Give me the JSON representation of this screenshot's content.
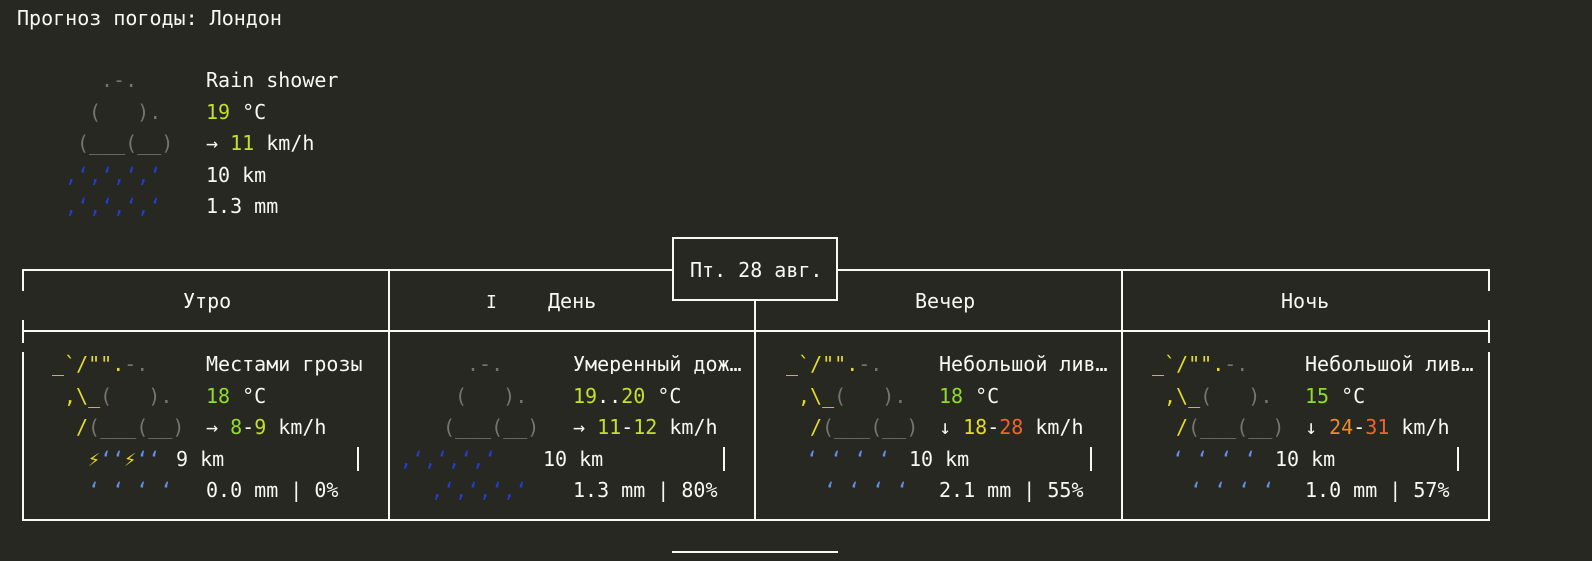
{
  "title": "Прогноз погоды: Лондон",
  "current": {
    "condition": "Rain shower",
    "temp_value": "19",
    "temp_unit": "°C",
    "wind_dir": "→",
    "wind_value": "11",
    "wind_unit": "km/h",
    "visibility": "10 km",
    "precip": "1.3 mm"
  },
  "date_label": "Пт. 28 авг.",
  "periods": [
    {
      "name": "Утро",
      "condition": "Местами грозы",
      "temp": [
        "18"
      ],
      "temp_unit": "°C",
      "wind_dir": "→",
      "wind": [
        "8",
        "9"
      ],
      "wind_unit": "km/h",
      "visibility": "9 km",
      "precip": "0.0 mm | 0%"
    },
    {
      "name": "День",
      "condition": "Умеренный дождь",
      "temp": [
        "19",
        "20"
      ],
      "temp_unit": "°C",
      "wind_dir": "→",
      "wind": [
        "11",
        "12"
      ],
      "wind_unit": "km/h",
      "visibility": "10 km",
      "precip": "1.3 mm | 80%"
    },
    {
      "name": "Вечер",
      "condition": "Небольшой ливневый дождь",
      "temp": [
        "18"
      ],
      "temp_unit": "°C",
      "wind_dir": "↓",
      "wind": [
        "18",
        "28"
      ],
      "wind_unit": "km/h",
      "visibility": "10 km",
      "precip": "2.1 mm | 55%"
    },
    {
      "name": "Ночь",
      "condition": "Небольшой ливневый дождь",
      "temp": [
        "15"
      ],
      "temp_unit": "°C",
      "wind_dir": "↓",
      "wind": [
        "24",
        "31"
      ],
      "wind_unit": "km/h",
      "visibility": "10 km",
      "precip": "1.0 mm | 57%"
    }
  ],
  "colors": {
    "background": "#272822",
    "text": "#f8f8f2",
    "cloud_gray": "#75756e",
    "yellow": "#e6db27",
    "lime": "#c3e02a",
    "green": "#8fdc2c",
    "orange": "#f08a22",
    "red": "#f0642a",
    "rain_dark_blue": "#1f3fcf",
    "rain_light_blue": "#5f8fe8"
  }
}
